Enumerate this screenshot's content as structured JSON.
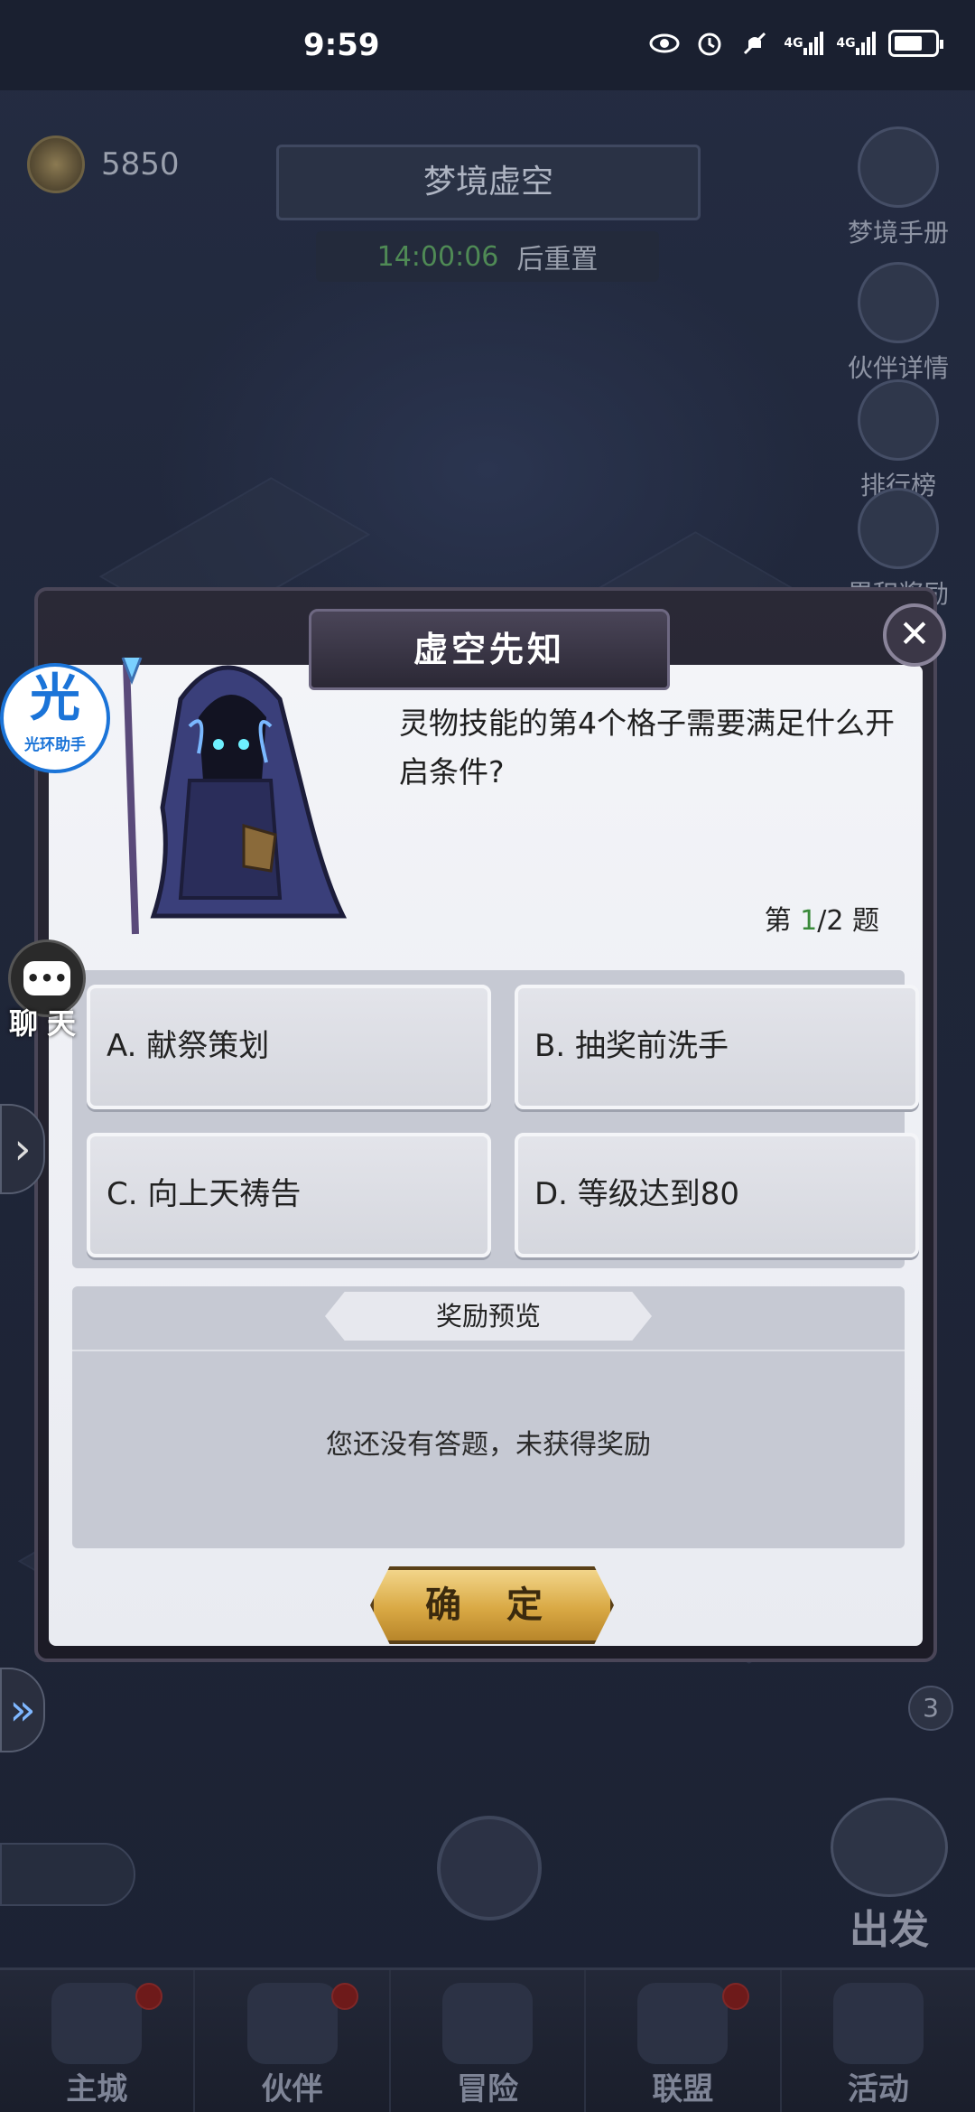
{
  "status_bar": {
    "time": "9:59",
    "icons": [
      "eye-icon",
      "alarm-icon",
      "mute-icon",
      "signal-4g-icon",
      "signal-4g-icon",
      "battery-icon"
    ],
    "net_label_1": "4G",
    "net_label_2": "4G"
  },
  "header": {
    "currency_value": "5850",
    "title": "梦境虚空",
    "timer_value": "14:00:06",
    "timer_suffix": "后重置"
  },
  "side_menu": [
    {
      "label": "梦境手册",
      "icon": "book-icon"
    },
    {
      "label": "伙伴详情",
      "icon": "partner-icon"
    },
    {
      "label": "排行榜",
      "icon": "trophy-icon"
    },
    {
      "label": "累积奖励",
      "icon": "reward-icon"
    }
  ],
  "helper_widget": {
    "glyph": "光",
    "label": "光环助手"
  },
  "chat_widget": {
    "label": "聊天"
  },
  "dialog": {
    "title": "虚空先知",
    "question": "灵物技能的第4个格子需要满足什么开启条件?",
    "progress_prefix": "第 ",
    "progress_current": "1",
    "progress_total": "/2 题",
    "options": [
      {
        "label": "A. 献祭策划"
      },
      {
        "label": "B. 抽奖前洗手"
      },
      {
        "label": "C. 向上天祷告"
      },
      {
        "label": "D. 等级达到80"
      }
    ],
    "reward_header": "奖励预览",
    "reward_empty": "您还没有答题，未获得奖励",
    "confirm_label": "确 定"
  },
  "depart_label": "出发",
  "badge_count": "3",
  "bottom_nav": [
    {
      "label": "主城",
      "has_dot": true
    },
    {
      "label": "伙伴",
      "has_dot": true
    },
    {
      "label": "冒险",
      "has_dot": false
    },
    {
      "label": "联盟",
      "has_dot": true
    },
    {
      "label": "活动",
      "has_dot": false
    }
  ]
}
